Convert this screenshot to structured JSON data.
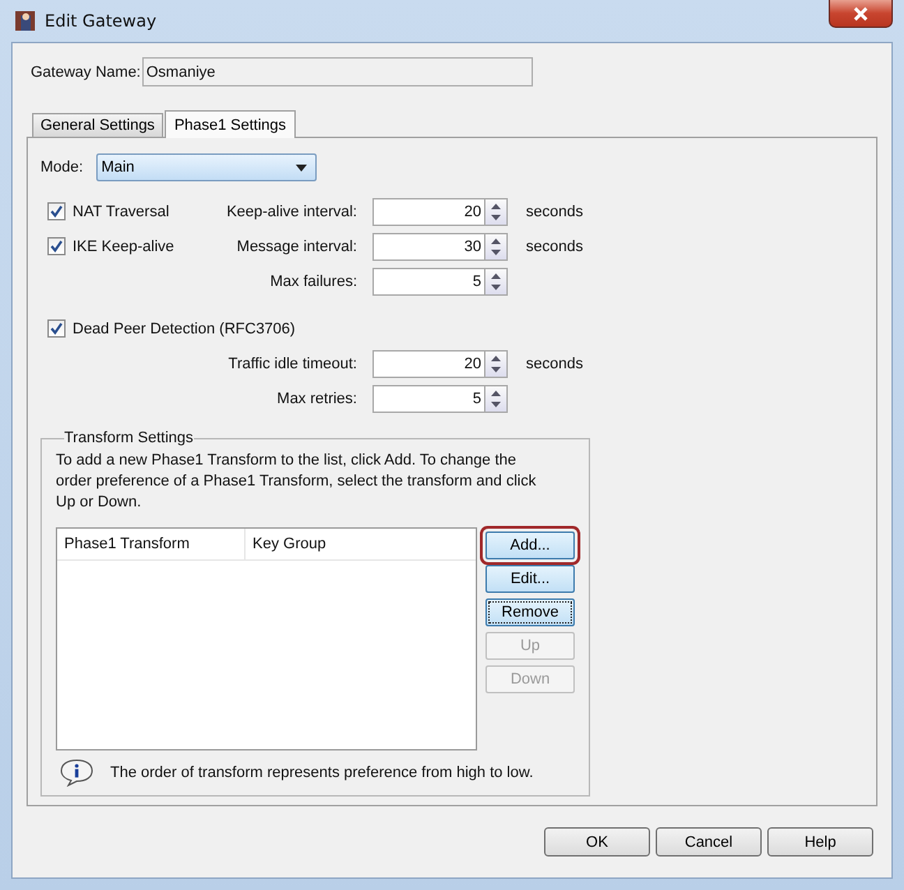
{
  "window": {
    "title": "Edit Gateway"
  },
  "gateway_name": {
    "label": "Gateway Name:",
    "value": "Osmaniye"
  },
  "tabs": [
    {
      "label": "General Settings",
      "selected": false
    },
    {
      "label": "Phase1 Settings",
      "selected": true
    }
  ],
  "mode": {
    "label": "Mode:",
    "value": "Main"
  },
  "settings_rows": [
    {
      "checkbox": {
        "label": "NAT Traversal",
        "checked": true
      },
      "field": {
        "label": "Keep-alive interval:",
        "value": "20",
        "unit": "seconds"
      }
    },
    {
      "checkbox": {
        "label": "IKE Keep-alive",
        "checked": true
      },
      "field": {
        "label": "Message interval:",
        "value": "30",
        "unit": "seconds"
      }
    },
    {
      "field": {
        "label": "Max failures:",
        "value": "5"
      }
    },
    {
      "checkbox": {
        "label": "Dead Peer Detection (RFC3706)",
        "checked": true
      }
    },
    {
      "field": {
        "label": "Traffic idle timeout:",
        "value": "20",
        "unit": "seconds"
      }
    },
    {
      "field": {
        "label": "Max retries:",
        "value": "5"
      }
    }
  ],
  "transform_settings": {
    "title": "Transform Settings",
    "description": "To add a new Phase1 Transform to the list, click Add. To change the order preference of a Phase1 Transform, select the transform and click Up or Down.",
    "table": {
      "columns": [
        "Phase1 Transform",
        "Key Group"
      ]
    },
    "buttons": [
      {
        "label": "Add...",
        "disabled": false,
        "focused": false,
        "highlighted": true
      },
      {
        "label": "Edit...",
        "disabled": false,
        "focused": false,
        "highlighted": false
      },
      {
        "label": "Remove",
        "disabled": false,
        "focused": true,
        "highlighted": false
      },
      {
        "label": "Up",
        "disabled": true,
        "focused": false,
        "highlighted": false
      },
      {
        "label": "Down",
        "disabled": true,
        "focused": false,
        "highlighted": false
      }
    ],
    "note": "The order of transform represents preference from high to low."
  },
  "footer_buttons": [
    "OK",
    "Cancel",
    "Help"
  ]
}
